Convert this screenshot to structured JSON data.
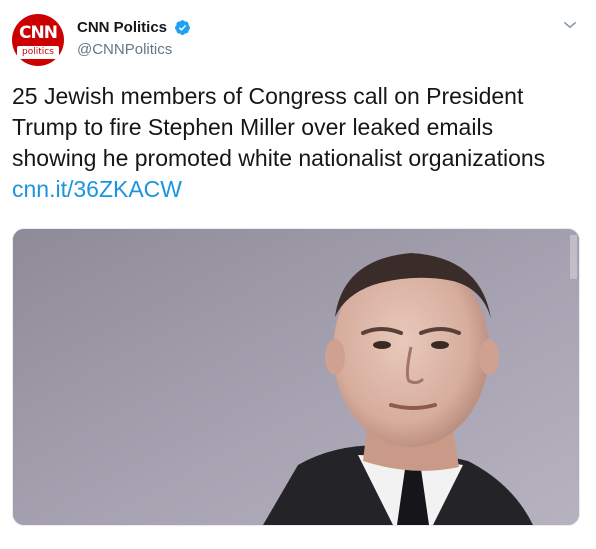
{
  "account": {
    "display_name": "CNN Politics",
    "handle": "@CNNPolitics",
    "avatar_main": "CNN",
    "avatar_sub": "politics",
    "verified": true
  },
  "tweet": {
    "lines": [
      "25 Jewish members of Congress call on President",
      "Trump to fire Stephen Miller over leaked emails",
      "showing he promoted white nationalist organizations"
    ],
    "link": "cnn.it/36ZKACW"
  },
  "icons": {
    "verified": "verified-badge-icon",
    "menu": "chevron-down-icon"
  },
  "colors": {
    "brand_red": "#cc0000",
    "verified_blue": "#1da1f2",
    "link": "#1b95e0",
    "handle_gray": "#657786"
  }
}
